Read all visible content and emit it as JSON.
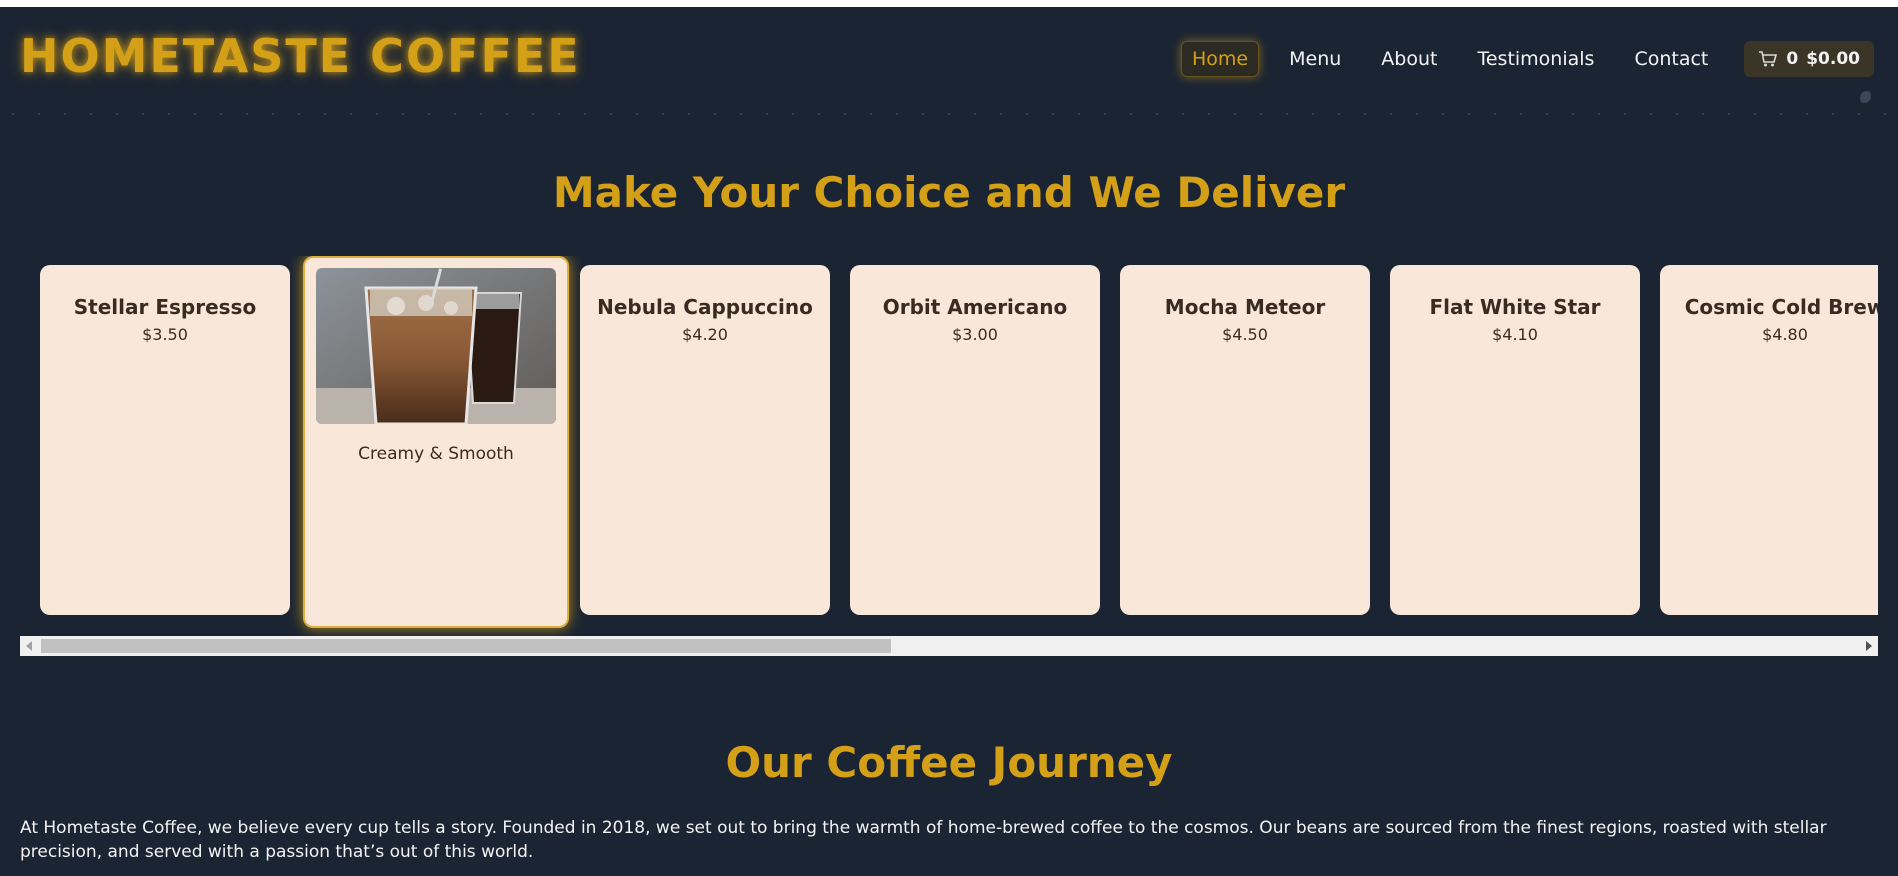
{
  "brand": {
    "logo": "HOMETASTE COFFEE"
  },
  "nav": {
    "items": [
      "Home",
      "Menu",
      "About",
      "Testimonials",
      "Contact"
    ],
    "active": "Home",
    "cart": {
      "count": "0",
      "total": "$0.00",
      "icon": "cart-icon"
    }
  },
  "choice": {
    "title": "Make Your Choice and We Deliver",
    "products": [
      {
        "name": "Stellar Espresso",
        "price": "$3.50"
      },
      {
        "name": "",
        "price": "",
        "tagline": "Creamy & Smooth",
        "image": "iced-coffee-photo"
      },
      {
        "name": "Nebula Cappuccino",
        "price": "$4.20"
      },
      {
        "name": "Orbit Americano",
        "price": "$3.00"
      },
      {
        "name": "Mocha Meteor",
        "price": "$4.50"
      },
      {
        "name": "Flat White Star",
        "price": "$4.10"
      },
      {
        "name": "Cosmic Cold Brew",
        "price": "$4.80"
      }
    ],
    "scroll_position": 0.45
  },
  "journey": {
    "title": "Our Coffee Journey",
    "text": "At Hometaste Coffee, we believe every cup tells a story. Founded in 2018, we set out to bring the warmth of home-brewed coffee to the cosmos. Our beans are sourced from the finest regions, roasted with stellar precision, and served with a passion that’s out of this world."
  },
  "colors": {
    "accent": "#d4a017",
    "background": "#1b2433",
    "card": "#f9e8da"
  }
}
